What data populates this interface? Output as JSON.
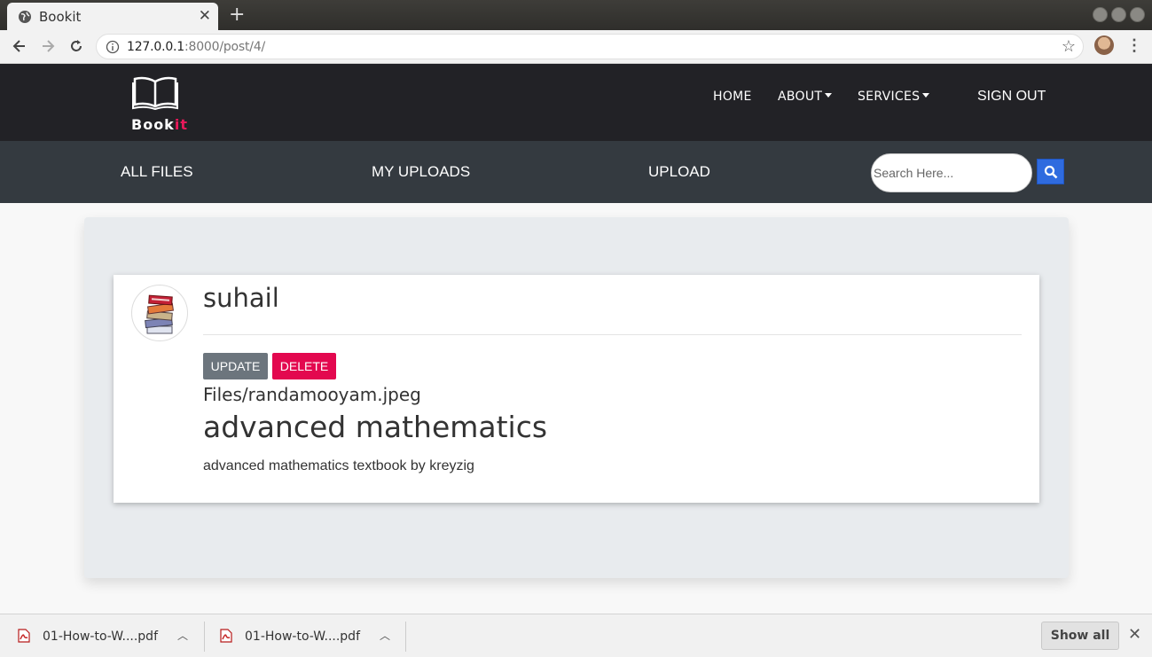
{
  "browser": {
    "tab_title": "Bookit",
    "tab_close": "✕",
    "new_tab": "+",
    "url_host": "127.0.0.1",
    "url_rest": ":8000/post/4/"
  },
  "site": {
    "brand": {
      "main": "Book",
      "accent": "it"
    },
    "nav": {
      "home": "HOME",
      "about": "ABOUT",
      "services": "SERVICES",
      "signout": "SIGN OUT"
    },
    "subnav": {
      "all_files": "ALL FILES",
      "my_uploads": "MY UPLOADS",
      "upload": "UPLOAD",
      "search_placeholder": "Search Here..."
    }
  },
  "post": {
    "author": "suhail",
    "update_label": "UPDATE",
    "delete_label": "DELETE",
    "file": "Files/randamooyam.jpeg",
    "title": "advanced mathematics",
    "description": "advanced mathematics textbook by kreyzig"
  },
  "downloads": {
    "items": [
      {
        "name": "01-How-to-W....pdf"
      },
      {
        "name": "01-How-to-W....pdf"
      }
    ],
    "show_all": "Show all",
    "close": "✕"
  },
  "colors": {
    "accent": "#e8195a",
    "navbar": "#222226",
    "subnav": "#343a40",
    "search_button": "#2f6bdf",
    "delete_button": "#e3084f",
    "update_button": "#6c757d"
  }
}
